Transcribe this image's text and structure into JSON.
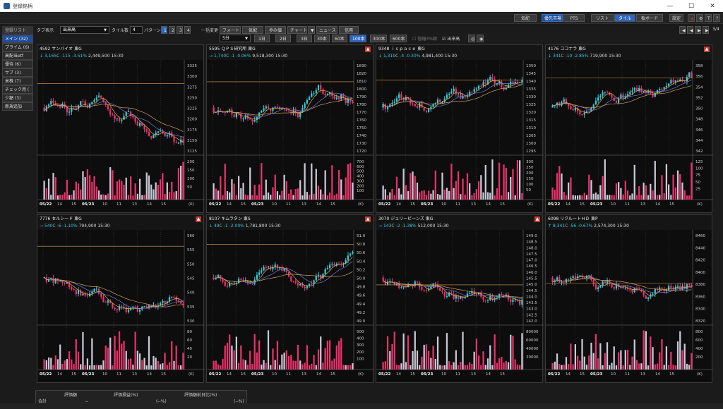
{
  "window": {
    "title": "登録銘柄",
    "min": "—",
    "max": "☐",
    "close": "✕"
  },
  "toolbar_top": {
    "kinds": "気配",
    "prio_market": "優先市場",
    "pts": "PTS",
    "list": "リスト",
    "tile": "タイル",
    "board": "板ボード",
    "settings": "設定"
  },
  "toolbar2": {
    "tab_display_label": "タブ表示",
    "tab_select": "出来高",
    "tile_count_label": "タイル数",
    "tile_count": "4",
    "pattern_label": "パターン",
    "patterns": [
      "1",
      "2",
      "3",
      "4"
    ],
    "bulk_change_label": "一括変更",
    "quote": "フォート",
    "kehai": "気配",
    "ayumi": "歩み値",
    "chart": "チャート",
    "news": "ニュース",
    "credit": "信用",
    "interval_select": "5分",
    "days": [
      "1日",
      "2日",
      "3日"
    ],
    "bars": [
      "30本",
      "60本",
      "100本",
      "300本",
      "600本"
    ],
    "bars_active": "100本",
    "check_price_limit": "值幅3%線",
    "check_volume": "出来高",
    "page": "3/4"
  },
  "sidebar": {
    "header": "登録リスト",
    "items": [
      "メイン (32)",
      "プライム (6)",
      "高配当etf",
      "優待 (6)",
      "サブ (3)",
      "米株 (7)",
      "チェック用 (",
      "少額 (3)",
      "新規追加"
    ]
  },
  "panels": [
    {
      "code": "4592",
      "name": "サンバイオ",
      "mkt": "東G",
      "arrow": "↓",
      "price": "3,165",
      "cflag": "C",
      "chg": "-115",
      "pct": "-3.51%",
      "vol": "2,449,500",
      "time": "15:30",
      "yticks": [
        "3325",
        "3300",
        "3275",
        "3250",
        "3225",
        "3200",
        "3175",
        "3150",
        "3125"
      ],
      "vticks": [
        "200",
        "150",
        "100",
        "50"
      ],
      "xticks": [
        "05/22",
        "14",
        "15",
        "05/23",
        "10",
        "11",
        "13",
        "14",
        "15"
      ],
      "unit": "(K)",
      "warn": false
    },
    {
      "code": "5595",
      "name": "ＱＰＳ研究所",
      "mkt": "東G",
      "arrow": "→",
      "price": "1,740",
      "cflag": "C",
      "chg": "-1",
      "pct": "-0.06%",
      "vol": "9,518,300",
      "time": "15:30",
      "yticks": [
        "1830",
        "1820",
        "1810",
        "1800",
        "1790",
        "1780",
        "1770",
        "1760",
        "1750",
        "1740",
        "1730",
        "1720"
      ],
      "vticks": [
        "700",
        "600",
        "500",
        "400",
        "300",
        "200",
        "100"
      ],
      "xticks": [
        "05/22",
        "14",
        "15",
        "05/23",
        "10",
        "11",
        "13",
        "14",
        "15"
      ],
      "unit": "(K)",
      "warn": true
    },
    {
      "code": "9348",
      "name": "ｉｓｐａｃｅ",
      "mkt": "東G",
      "arrow": "↓",
      "price": "1,319",
      "cflag": "C",
      "chg": "-4",
      "pct": "-0.30%",
      "vol": "4,981,400",
      "time": "15:30",
      "yticks": [
        "1350",
        "1345",
        "1340",
        "1335",
        "1330",
        "1325",
        "1320",
        "1315",
        "1310",
        "1305",
        "1300",
        "1295"
      ],
      "vticks": [
        "300",
        "250",
        "200",
        "150",
        "100",
        "50"
      ],
      "xticks": [
        "05/22",
        "14",
        "15",
        "05/23",
        "10",
        "11",
        "13",
        "14",
        "15"
      ],
      "unit": "(K)",
      "warn": false
    },
    {
      "code": "4176",
      "name": "ココナラ",
      "mkt": "東G",
      "arrow": "↓",
      "price": "341",
      "cflag": "C",
      "chg": "-10",
      "pct": "-2.85%",
      "vol": "719,900",
      "time": "15:30",
      "yticks": [
        "358",
        "356",
        "354",
        "352",
        "350",
        "348",
        "346",
        "344",
        "342"
      ],
      "vticks": [
        "125",
        "100",
        "75",
        "50",
        "25"
      ],
      "xticks": [
        "05/22",
        "14",
        "15",
        "05/23",
        "10",
        "11",
        "13",
        "14",
        "15"
      ],
      "unit": "(K)",
      "warn": true
    },
    {
      "code": "7776",
      "name": "セルシード",
      "mkt": "東G",
      "arrow": "→",
      "price": "540",
      "cflag": "C",
      "chg": "-6",
      "pct": "-1.10%",
      "vol": "794,900",
      "time": "15:30",
      "yticks": [
        "560",
        "555",
        "550",
        "545",
        "540",
        "535",
        "530"
      ],
      "vticks": [
        "80",
        "60",
        "40",
        "20"
      ],
      "xticks": [
        "05/22",
        "14",
        "15",
        "05/23",
        "10",
        "11",
        "13",
        "14",
        "15"
      ],
      "unit": "(K)",
      "warn": true
    },
    {
      "code": "8107",
      "name": "キムラタン",
      "mkt": "東S",
      "arrow": "↓",
      "price": "49",
      "cflag": "C",
      "chg": "-1",
      "pct": "-2.00%",
      "vol": "1,781,800",
      "time": "15:30",
      "yticks": [
        "51.0",
        "50.8",
        "50.6",
        "50.4",
        "50.2",
        "50.0",
        "49.8",
        "49.6",
        "49.4",
        "49.2",
        "49.0"
      ],
      "vticks": [
        "500",
        "400",
        "300",
        "200",
        "100"
      ],
      "xticks": [
        "05/22",
        "14",
        "15",
        "05/23",
        "10",
        "11",
        "13",
        "14",
        "15"
      ],
      "unit": "(K)",
      "warn": true
    },
    {
      "code": "3070",
      "name": "ジェリービーンズ",
      "mkt": "東G",
      "arrow": "→",
      "price": "143",
      "cflag": "C",
      "chg": "-2",
      "pct": "-1.38%",
      "vol": "512,000",
      "time": "15:30",
      "yticks": [
        "149.0",
        "148.5",
        "148.0",
        "147.5",
        "147.0",
        "146.5",
        "146.0",
        "145.5",
        "145.0",
        "144.5",
        "144.0",
        "143.5",
        "143.0",
        "142.5",
        "142.0"
      ],
      "vticks": [
        "80000",
        "60000",
        "40000",
        "20000"
      ],
      "xticks": [
        "05/22",
        "14",
        "15",
        "05/23",
        "10",
        "11",
        "13",
        "14",
        "15"
      ],
      "unit": "",
      "warn": true
    },
    {
      "code": "6098",
      "name": "リクルートＨＤ",
      "mkt": "東P",
      "arrow": "↑",
      "price": "8,341",
      "cflag": "C",
      "chg": "-56",
      "pct": "-0.67%",
      "vol": "2,574,300",
      "time": "15:30",
      "yticks": [
        "8460",
        "8440",
        "8420",
        "8400",
        "8380",
        "8360",
        "8340",
        "8320"
      ],
      "vticks": [
        "800",
        "600",
        "400",
        "200"
      ],
      "xticks": [
        "05/22",
        "14",
        "15",
        "05/23",
        "10",
        "11",
        "13",
        "14",
        "15"
      ],
      "unit": "(K)",
      "warn": false
    }
  ],
  "bottom": {
    "total": "合計",
    "h1": "評価額",
    "h2": "評価損益(%)",
    "h3": "評価額前日比(%)",
    "v1": "--",
    "v2": "(--%)",
    "v3": "(--%)"
  },
  "colors": {
    "up": "#37c8d8",
    "down": "#e8326b",
    "ma1": "#e8b04a",
    "ma2": "#6b7fd6",
    "ma3": "#d4a05a",
    "hline": "#e0a050"
  }
}
